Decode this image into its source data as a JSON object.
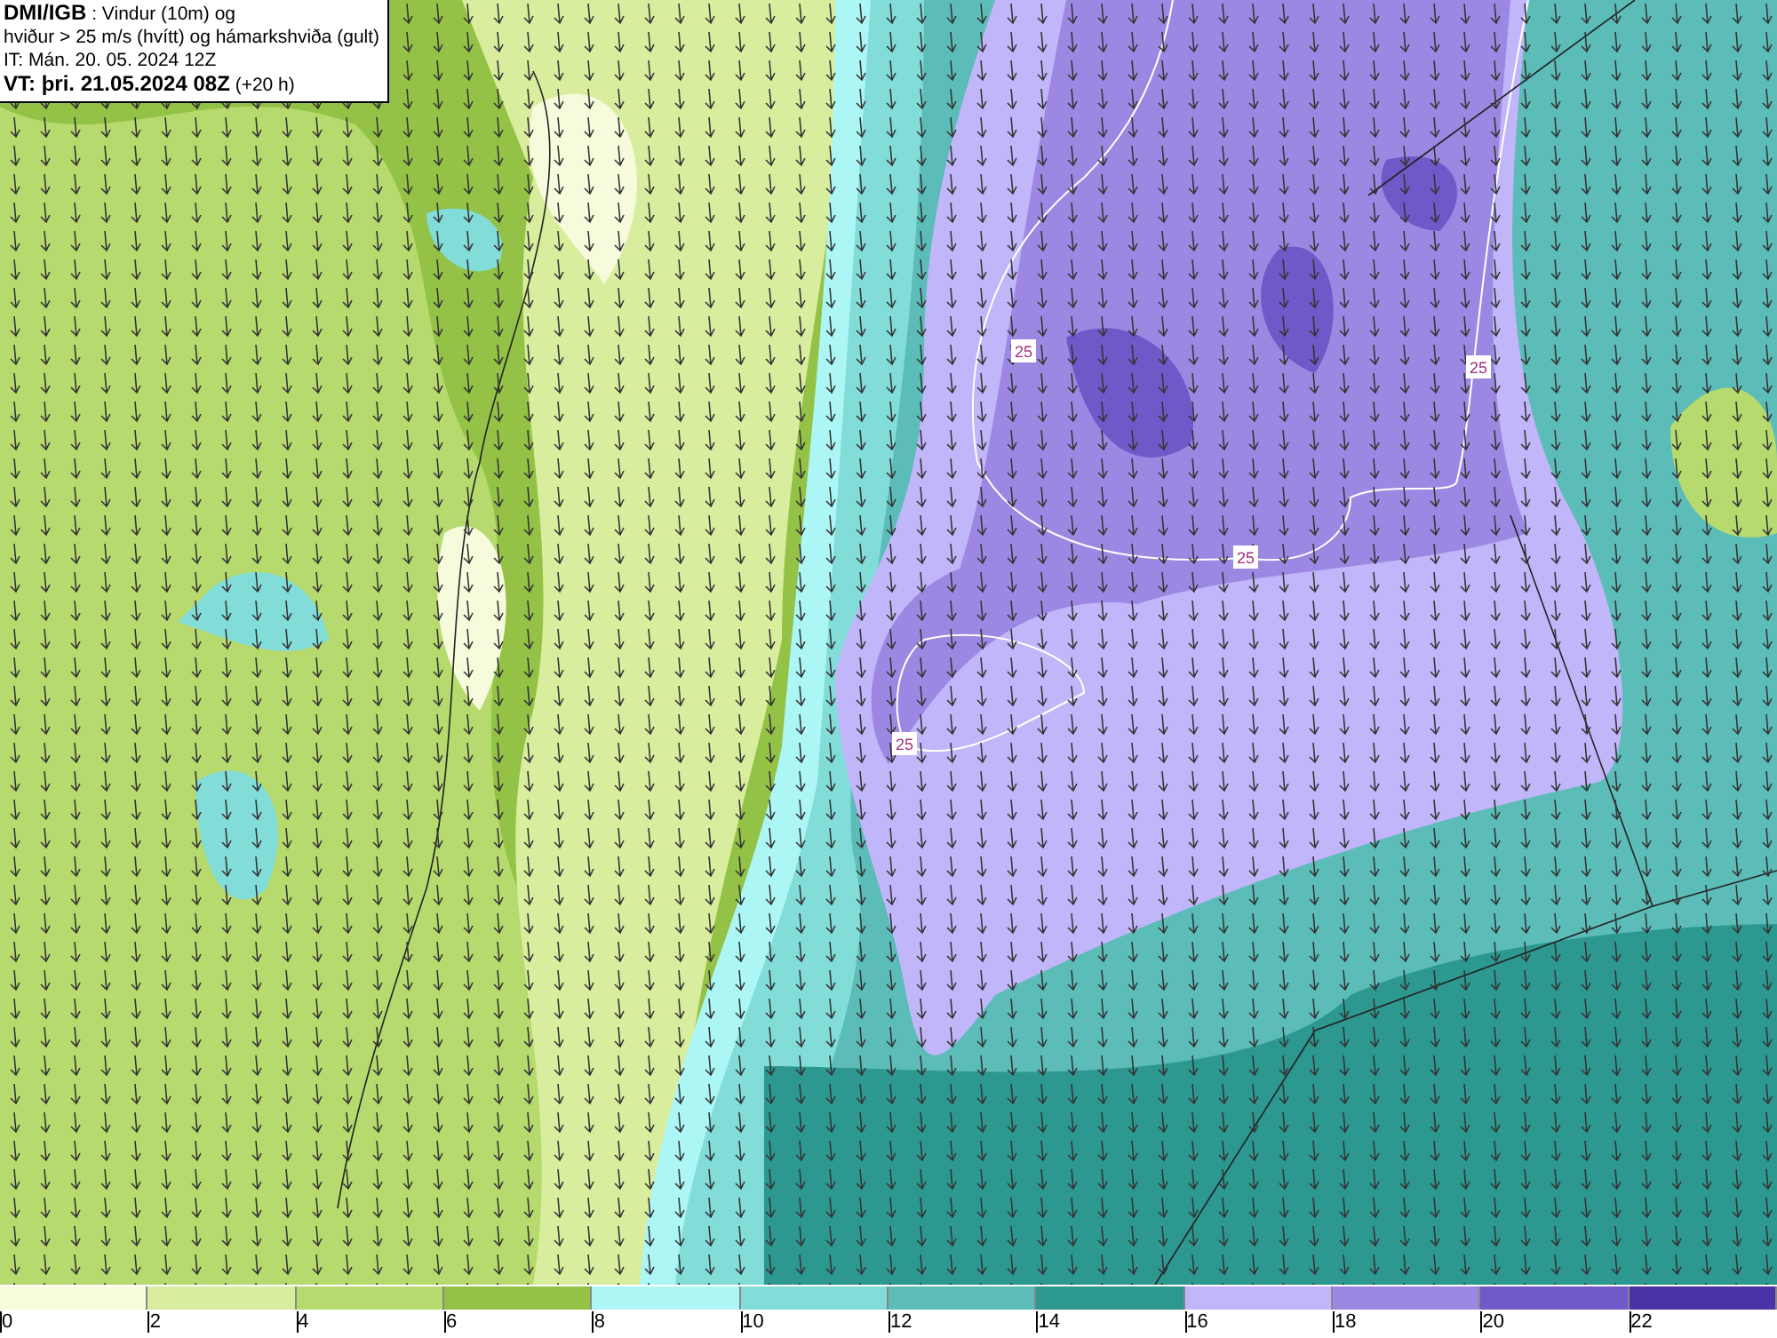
{
  "header": {
    "lines": [
      "**DMI/IGB** : Vindur (10m) og",
      "hviður > 25 m/s (hvítt) og hámarkshviða (gult)",
      "IT: Mán. 20. 05. 2024 12Z",
      "**VT: þri. 21.05.2024 08Z** (+20 h)"
    ]
  },
  "map": {
    "contour_labels": [
      "25",
      "25",
      "25",
      "25"
    ]
  },
  "colorbar": [
    {
      "label": "0",
      "color": "#f6fbdc"
    },
    {
      "label": "2",
      "color": "#d8ee9e"
    },
    {
      "label": "4",
      "color": "#b6da6e"
    },
    {
      "label": "6",
      "color": "#94c246"
    },
    {
      "label": "8",
      "color": "#acf7f5"
    },
    {
      "label": "10",
      "color": "#82dcd8"
    },
    {
      "label": "12",
      "color": "#5cbcb8"
    },
    {
      "label": "14",
      "color": "#2c9890"
    },
    {
      "label": "16",
      "color": "#c2b6fa"
    },
    {
      "label": "18",
      "color": "#9c88e2"
    },
    {
      "label": "20",
      "color": "#7058c8"
    },
    {
      "label": "22",
      "color": "#4a32a8"
    }
  ]
}
